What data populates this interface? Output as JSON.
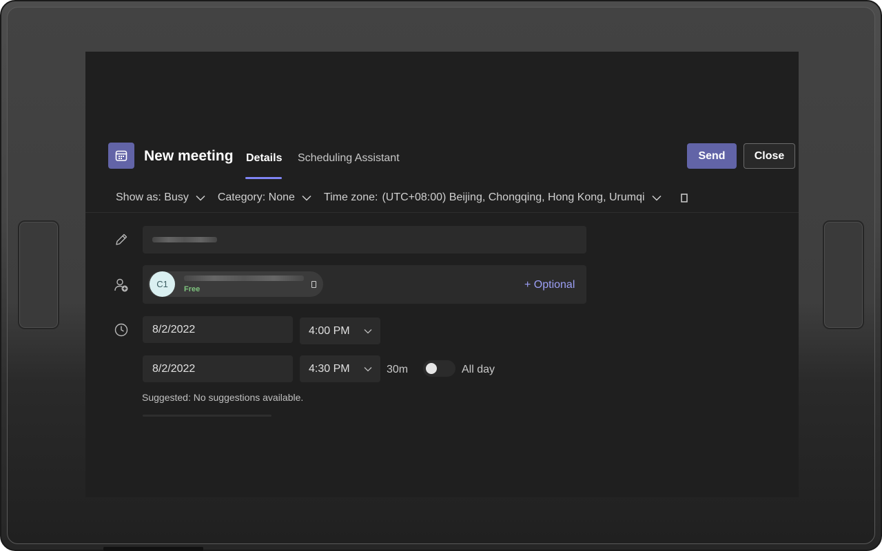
{
  "header": {
    "title": "New meeting",
    "tabs": [
      {
        "label": "Details",
        "active": true
      },
      {
        "label": "Scheduling Assistant",
        "active": false
      }
    ],
    "send_label": "Send",
    "close_label": "Close"
  },
  "toolbar": {
    "show_as": "Show as: Busy",
    "category": "Category: None",
    "time_zone_label": "Time zone:",
    "time_zone_value": "(UTC+08:00) Beijing, Chongqing, Hong Kong, Urumqi"
  },
  "attendees": {
    "avatar_initials": "C1",
    "status": "Free",
    "optional_label": "+ Optional"
  },
  "schedule": {
    "start_date": "8/2/2022",
    "start_time": "4:00 PM",
    "end_date": "8/2/2022",
    "end_time": "4:30 PM",
    "duration": "30m",
    "all_day_label": "All day",
    "all_day_on": false,
    "suggested": "Suggested: No suggestions available."
  },
  "colors": {
    "accent": "#6264a7",
    "link": "#9c9ff5",
    "free": "#7fc47f",
    "background": "#1f1f1f"
  },
  "icons": [
    "calendar-icon",
    "pencil-icon",
    "add-person-icon",
    "clock-icon",
    "chevron-down-icon",
    "pop-out-icon"
  ]
}
